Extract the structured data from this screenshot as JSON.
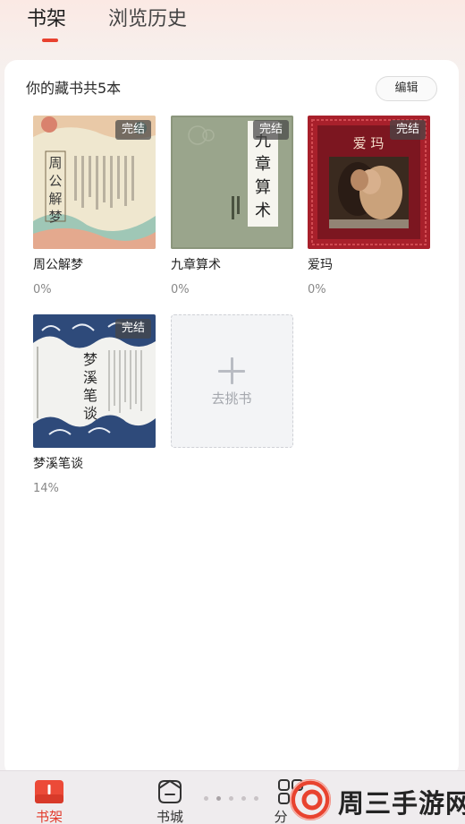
{
  "tabs": [
    {
      "label": "书架",
      "active": true
    },
    {
      "label": "浏览历史",
      "active": false
    }
  ],
  "shelf": {
    "count_text": "你的藏书共5本",
    "edit_label": "编辑",
    "books": [
      {
        "title": "周公解梦",
        "progress": "0%",
        "badge": "完结",
        "cover_text": "周公解梦",
        "cover_theme": "cream-floral"
      },
      {
        "title": "九章算术",
        "progress": "0%",
        "badge": "完结",
        "cover_text": "九章算术",
        "cover_theme": "sage-scroll"
      },
      {
        "title": "爱玛",
        "progress": "0%",
        "badge": "完结",
        "cover_text": "爱玛",
        "cover_theme": "red-ornate-photo"
      },
      {
        "title": "梦溪笔谈",
        "progress": "14%",
        "badge": "完结",
        "cover_text": "梦溪笔谈",
        "cover_theme": "blue-cloud"
      }
    ],
    "add_label": "去挑书"
  },
  "bottom_nav": [
    {
      "label": "书架",
      "icon": "book-shelf-icon",
      "active": true
    },
    {
      "label": "书城",
      "icon": "book-store-icon",
      "active": false
    },
    {
      "label": "分",
      "icon": "category-icon",
      "active": false
    }
  ],
  "watermark": {
    "text": "周三手游网"
  },
  "colors": {
    "accent": "#e8412f",
    "badge_bg": "#474747",
    "text_muted": "#888888"
  }
}
